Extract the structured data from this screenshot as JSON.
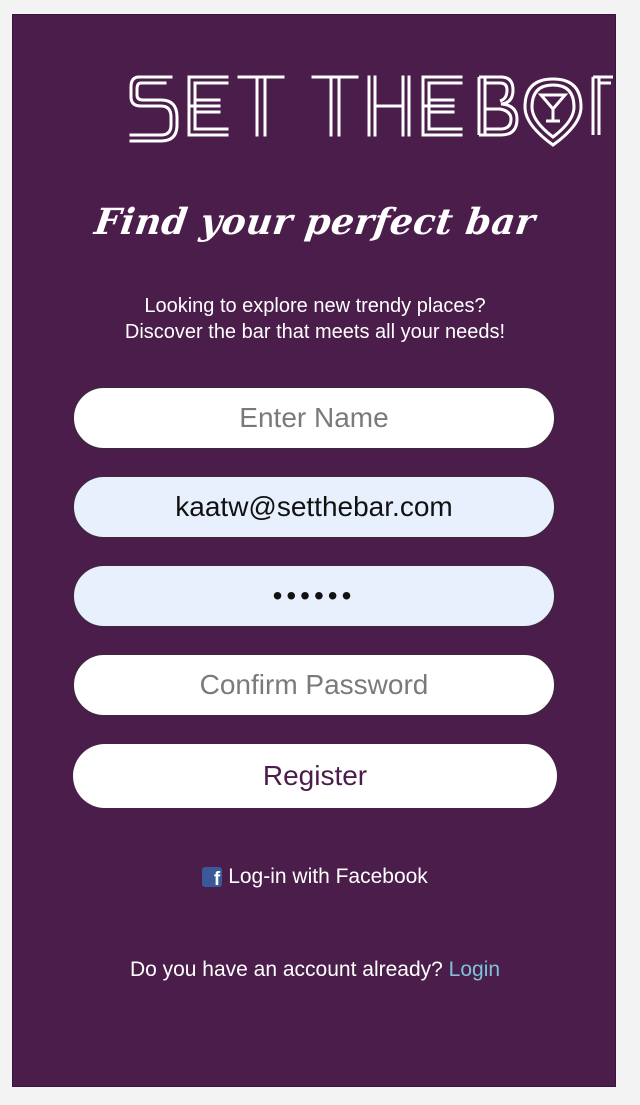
{
  "logo": {
    "alt_text": "SET THE BAR",
    "icon": "cocktail-pin-icon"
  },
  "hero": {
    "tagline": "Find your perfect bar",
    "subtitle_line1": "Looking to explore new trendy places?",
    "subtitle_line2": "Discover the bar that meets all your needs!"
  },
  "form": {
    "name_placeholder": "Enter Name",
    "email_value": "kaatw@setthebar.com",
    "password_value": "••••••",
    "confirm_placeholder": "Confirm Password",
    "register_label": "Register"
  },
  "social": {
    "facebook_label": "Log-in with Facebook",
    "icon": "facebook-icon"
  },
  "footer": {
    "account_text": "Do you have an account already?",
    "login_label": "Login"
  },
  "colors": {
    "background": "#4a1d4b",
    "autofill": "#e8f0fe",
    "link": "#7fc1da",
    "facebook": "#3b5998"
  }
}
